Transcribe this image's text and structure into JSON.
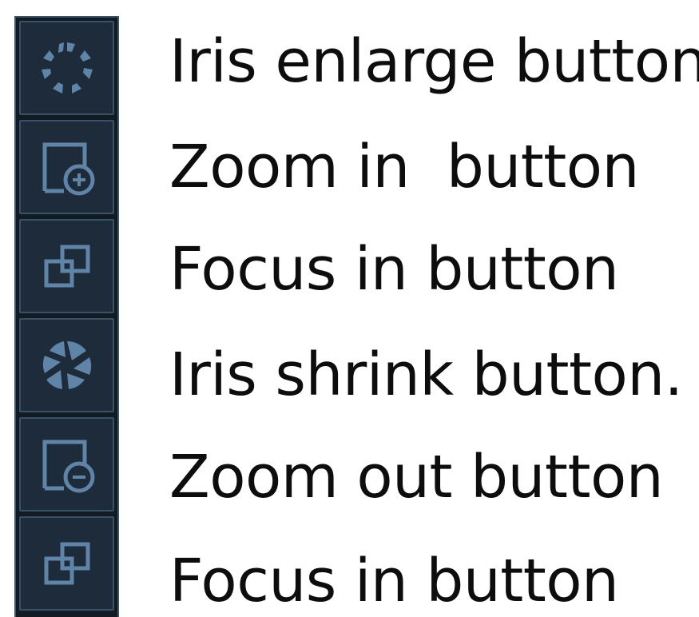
{
  "colors": {
    "panel_background": "#121a24",
    "button_background": "#1d2b3a",
    "button_border": "#3b5166",
    "icon_color": "#5f84a8",
    "label_color": "#0d0d0d"
  },
  "toolbar": {
    "buttons": [
      {
        "icon": "iris-enlarge-icon",
        "label": "Iris enlarge button"
      },
      {
        "icon": "zoom-in-icon",
        "label": "Zoom in  button"
      },
      {
        "icon": "focus-in-icon",
        "label": "Focus in button"
      },
      {
        "icon": "iris-shrink-icon",
        "label": "Iris shrink button."
      },
      {
        "icon": "zoom-out-icon",
        "label": "Zoom out button"
      },
      {
        "icon": "focus-in-icon",
        "label": "Focus in button"
      }
    ]
  }
}
